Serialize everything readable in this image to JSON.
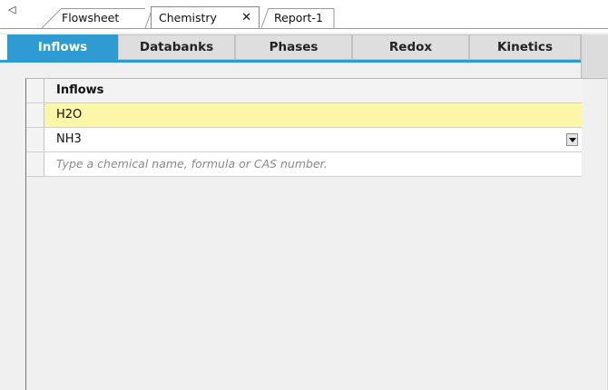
{
  "doc_tabs": {
    "scroll_left_glyph": "◁",
    "tabs": [
      {
        "label": "Flowsheet"
      },
      {
        "label": "Chemistry",
        "close_glyph": "✕"
      },
      {
        "label": "Report-1"
      }
    ]
  },
  "section_tabs": [
    {
      "label": "Inflows",
      "active": true
    },
    {
      "label": "Databanks"
    },
    {
      "label": "Phases"
    },
    {
      "label": "Redox"
    },
    {
      "label": "Kinetics"
    }
  ],
  "grid": {
    "header": "Inflows",
    "rows": [
      {
        "value": "H2O"
      },
      {
        "value": "NH3"
      }
    ],
    "new_row_placeholder": "Type a chemical name, formula or CAS number."
  },
  "colors": {
    "accent": "#2e9bd3",
    "selected_row": "#fcf6a8"
  }
}
